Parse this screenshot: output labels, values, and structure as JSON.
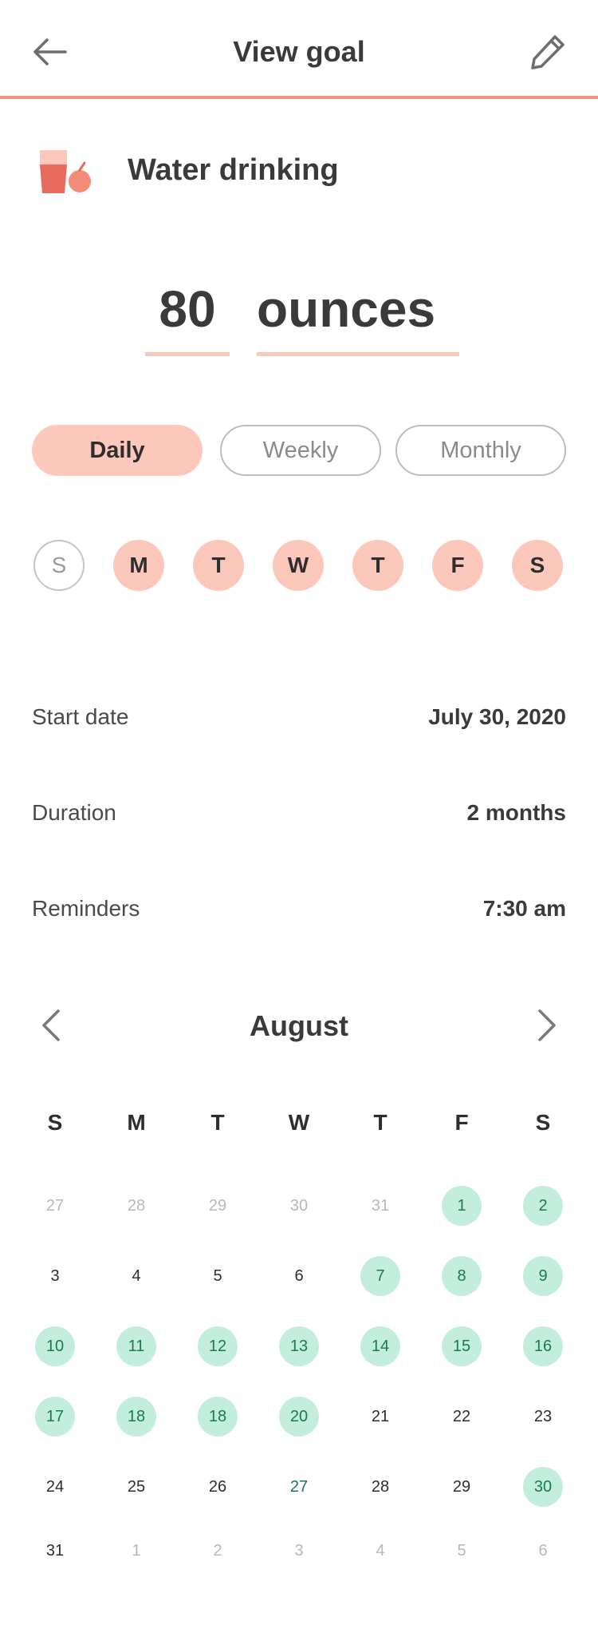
{
  "header": {
    "title": "View goal",
    "back_icon": "arrow-left-icon",
    "edit_icon": "pencil-icon"
  },
  "goal": {
    "name": "Water drinking",
    "icon": "water-glass-apple-icon",
    "amount": "80",
    "unit": "ounces"
  },
  "frequency": {
    "options": [
      "Daily",
      "Weekly",
      "Monthly"
    ],
    "selected": "Daily"
  },
  "days": [
    {
      "label": "S",
      "active": false
    },
    {
      "label": "M",
      "active": true
    },
    {
      "label": "T",
      "active": true
    },
    {
      "label": "W",
      "active": true
    },
    {
      "label": "T",
      "active": true
    },
    {
      "label": "F",
      "active": true
    },
    {
      "label": "S",
      "active": true
    }
  ],
  "details": {
    "start_date_label": "Start date",
    "start_date": "July 30, 2020",
    "duration_label": "Duration",
    "duration": "2 months",
    "reminders_label": "Reminders",
    "reminders": "7:30 am"
  },
  "calendar": {
    "month": "August",
    "weekdays": [
      "S",
      "M",
      "T",
      "W",
      "T",
      "F",
      "S"
    ],
    "weeks": [
      [
        {
          "d": "27",
          "o": true
        },
        {
          "d": "28",
          "o": true
        },
        {
          "d": "29",
          "o": true
        },
        {
          "d": "30",
          "o": true
        },
        {
          "d": "31",
          "o": true
        },
        {
          "d": "1",
          "c": true
        },
        {
          "d": "2",
          "c": true
        }
      ],
      [
        {
          "d": "3"
        },
        {
          "d": "4"
        },
        {
          "d": "5"
        },
        {
          "d": "6"
        },
        {
          "d": "7",
          "c": true
        },
        {
          "d": "8",
          "c": true
        },
        {
          "d": "9",
          "c": true
        }
      ],
      [
        {
          "d": "10",
          "c": true
        },
        {
          "d": "11",
          "c": true
        },
        {
          "d": "12",
          "c": true
        },
        {
          "d": "13",
          "c": true
        },
        {
          "d": "14",
          "c": true
        },
        {
          "d": "15",
          "c": true
        },
        {
          "d": "16",
          "c": true
        }
      ],
      [
        {
          "d": "17",
          "c": true
        },
        {
          "d": "18",
          "c": true
        },
        {
          "d": "18",
          "c": true
        },
        {
          "d": "20",
          "c": true
        },
        {
          "d": "21"
        },
        {
          "d": "22"
        },
        {
          "d": "23"
        }
      ],
      [
        {
          "d": "24"
        },
        {
          "d": "25"
        },
        {
          "d": "26"
        },
        {
          "d": "27",
          "t": true
        },
        {
          "d": "28"
        },
        {
          "d": "29"
        },
        {
          "d": "30",
          "c": true
        }
      ],
      [
        {
          "d": "31"
        },
        {
          "d": "1",
          "o": true
        },
        {
          "d": "2",
          "o": true
        },
        {
          "d": "3",
          "o": true
        },
        {
          "d": "4",
          "o": true
        },
        {
          "d": "5",
          "o": true
        },
        {
          "d": "6",
          "o": true
        }
      ]
    ]
  },
  "colors": {
    "accent": "#f19282",
    "accent_light": "#fcc8bc",
    "completed_bg": "#c3eedd",
    "completed_text": "#1a7a55"
  }
}
